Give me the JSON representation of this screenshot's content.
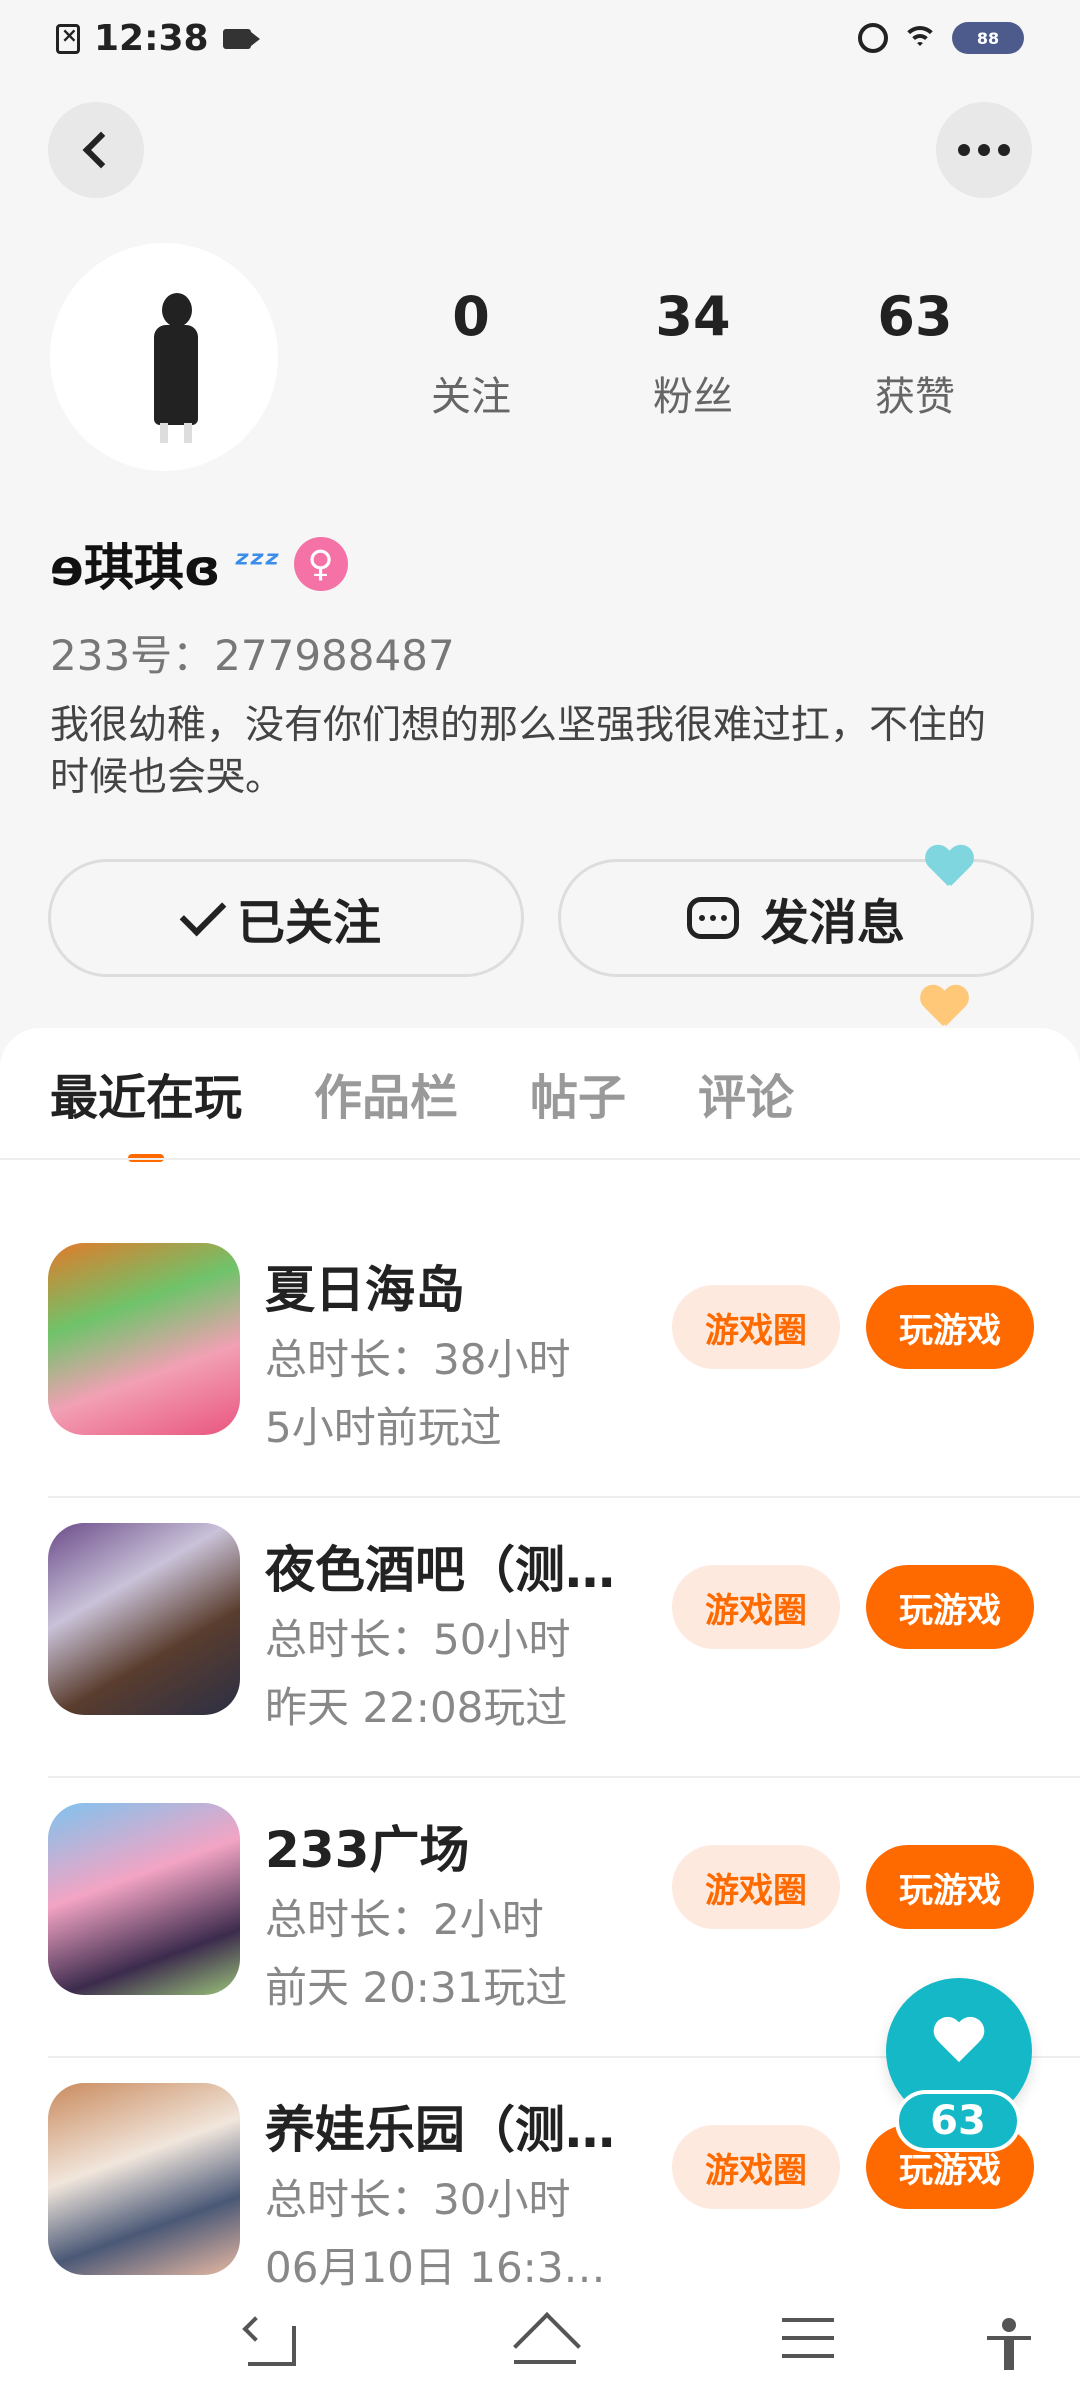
{
  "status_bar": {
    "time": "12:38",
    "battery": "88"
  },
  "profile": {
    "name": "ɘ琪琪ɞ",
    "zzz": "ᶻᶻᶻ",
    "gender_symbol": "♀",
    "uid": "233号：277988487",
    "bio": "我很幼稚，没有你们想的那么坚强我很难过扛，不住的时候也会哭。",
    "stats": [
      {
        "value": "0",
        "label": "关注"
      },
      {
        "value": "34",
        "label": "粉丝"
      },
      {
        "value": "63",
        "label": "获赞"
      }
    ]
  },
  "actions": {
    "follow_label": "已关注",
    "message_label": "发消息"
  },
  "tabs": [
    "最近在玩",
    "作品栏",
    "帖子",
    "评论"
  ],
  "games": [
    {
      "title": "夏日海岛",
      "duration": "总时长：38小时",
      "last_played": "5小时前玩过",
      "circle_label": "游戏圈",
      "play_label": "玩游戏"
    },
    {
      "title": "夜色酒吧（测…",
      "duration": "总时长：50小时",
      "last_played": "昨天 22:08玩过",
      "circle_label": "游戏圈",
      "play_label": "玩游戏"
    },
    {
      "title": "233广场",
      "duration": "总时长：2小时",
      "last_played": "前天 20:31玩过",
      "circle_label": "游戏圈",
      "play_label": "玩游戏"
    },
    {
      "title": "养娃乐园（测…",
      "duration": "总时长：30小时",
      "last_played": "06月10日 16:3…",
      "circle_label": "游戏圈",
      "play_label": "玩游戏"
    }
  ],
  "like_fab": {
    "count": "63"
  },
  "colors": {
    "accent": "#ff6a00",
    "like": "#14b8c6",
    "gender": "#f472a5"
  }
}
